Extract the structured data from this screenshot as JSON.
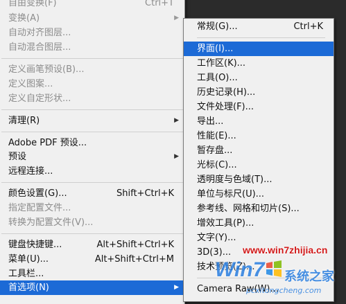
{
  "main_menu": {
    "items": [
      {
        "label": "自由变换(F)",
        "shortcut": "Ctrl+T",
        "disabled": true
      },
      {
        "label": "变换(A)",
        "disabled": true,
        "submenu": true
      },
      {
        "label": "自动对齐图层...",
        "disabled": true
      },
      {
        "label": "自动混合图层...",
        "disabled": true
      },
      {
        "label": "定义画笔预设(B)...",
        "disabled": true
      },
      {
        "label": "定义图案...",
        "disabled": true
      },
      {
        "label": "定义自定形状...",
        "disabled": true
      },
      {
        "label": "清理(R)",
        "submenu": true
      },
      {
        "label": "Adobe PDF 预设..."
      },
      {
        "label": "预设",
        "submenu": true
      },
      {
        "label": "远程连接..."
      },
      {
        "label": "颜色设置(G)...",
        "shortcut": "Shift+Ctrl+K"
      },
      {
        "label": "指定配置文件...",
        "disabled": true
      },
      {
        "label": "转换为配置文件(V)...",
        "disabled": true
      },
      {
        "label": "键盘快捷键...",
        "shortcut": "Alt+Shift+Ctrl+K"
      },
      {
        "label": "菜单(U)...",
        "shortcut": "Alt+Shift+Ctrl+M"
      },
      {
        "label": "工具栏..."
      },
      {
        "label": "首选项(N)",
        "submenu": true,
        "highlight": true
      }
    ]
  },
  "sub_menu": {
    "items": [
      {
        "label": "常规(G)...",
        "shortcut": "Ctrl+K"
      },
      {
        "label": "界面(I)...",
        "highlight": true
      },
      {
        "label": "工作区(K)..."
      },
      {
        "label": "工具(O)..."
      },
      {
        "label": "历史记录(H)..."
      },
      {
        "label": "文件处理(F)..."
      },
      {
        "label": "导出..."
      },
      {
        "label": "性能(E)..."
      },
      {
        "label": "暂存盘..."
      },
      {
        "label": "光标(C)..."
      },
      {
        "label": "透明度与色域(T)..."
      },
      {
        "label": "单位与标尺(U)..."
      },
      {
        "label": "参考线、网格和切片(S)..."
      },
      {
        "label": "增效工具(P)..."
      },
      {
        "label": "文字(Y)..."
      },
      {
        "label": "3D(3)..."
      },
      {
        "label": "技术预览(Z)..."
      },
      {
        "label": "Camera Raw(W)..."
      }
    ]
  },
  "watermark": {
    "url": "www.win7zhijia.cn",
    "logo_text": "Win7",
    "cn_text": "系统之家",
    "domain": "pcxitongcheng.com"
  },
  "colors": {
    "menu_bg": "#f0f0f0",
    "highlight": "#1c6ad6",
    "disabled_text": "#8c8c8c"
  }
}
